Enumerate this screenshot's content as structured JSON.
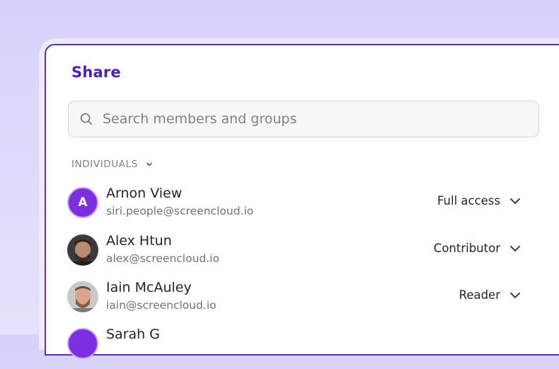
{
  "dialog": {
    "title": "Share"
  },
  "search": {
    "placeholder": "Search members and groups",
    "icon": "search-icon"
  },
  "section": {
    "label": "INDIVIDUALS",
    "icon": "chevron-down-icon"
  },
  "members": [
    {
      "initial": "A",
      "name": "Arnon View",
      "email": "siri.people@screencloud.io",
      "role": "Full access"
    },
    {
      "name": "Alex Htun",
      "email": "alex@screencloud.io",
      "role": "Contributor"
    },
    {
      "name": "Iain McAuley",
      "email": "iain@screencloud.io",
      "role": "Reader"
    },
    {
      "name": "Sarah G"
    }
  ],
  "colors": {
    "accent": "#4a1fc4",
    "avatar_bg": "#7b2fe0",
    "panel_border": "#5b2bd4"
  }
}
